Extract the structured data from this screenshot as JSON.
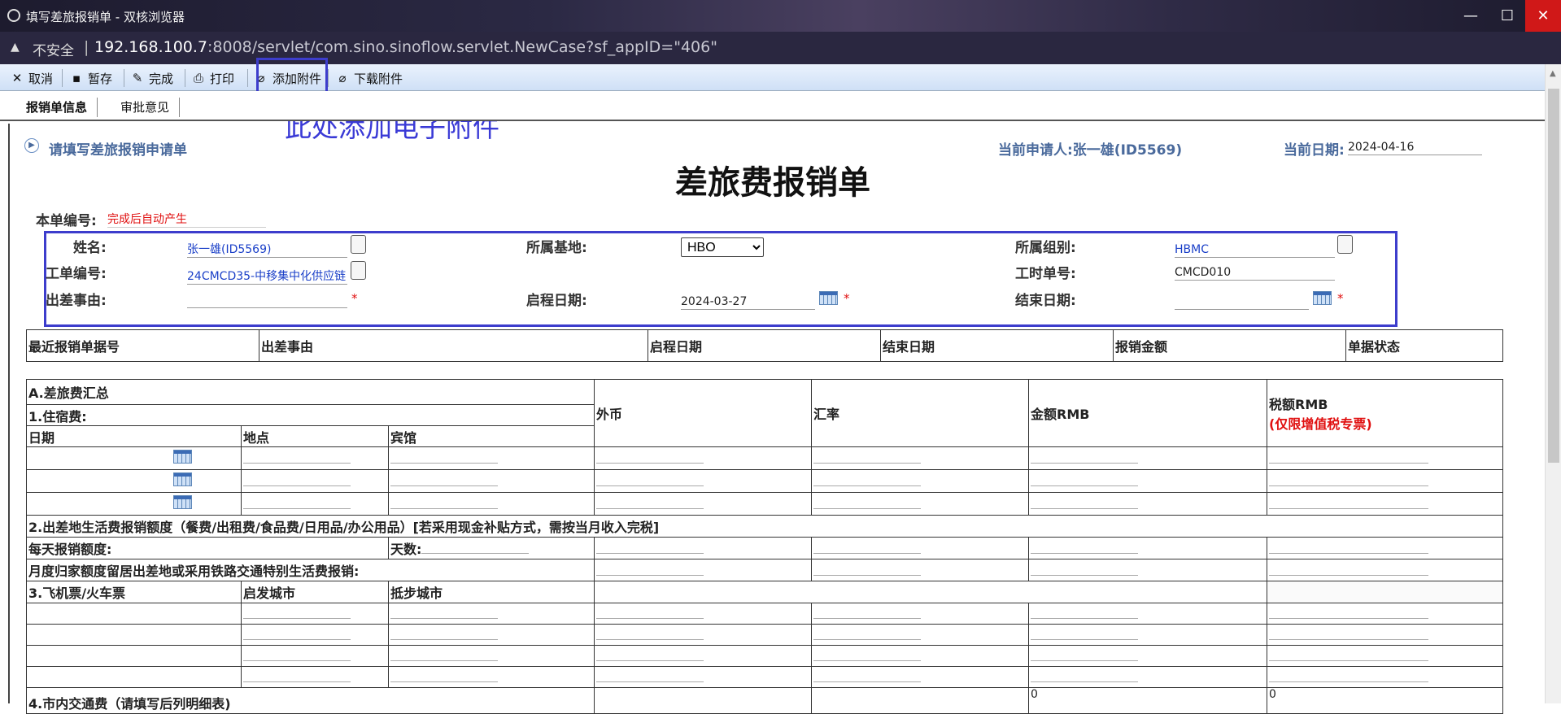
{
  "window": {
    "title": "填写差旅报销单 - 双核浏览器",
    "controls": {
      "minimize": "—",
      "maximize": "☐",
      "close": "✕"
    }
  },
  "address": {
    "insecure_label": "不安全",
    "separator": "|",
    "url_host": "192.168.100.7",
    "url_rest": ":8008/servlet/com.sino.sinoflow.servlet.NewCase?sf_appID=\"406\""
  },
  "toolbar": {
    "cancel": "取消",
    "save_draft": "暂存",
    "complete": "完成",
    "print": "打印",
    "add_attachment": "添加附件",
    "download_attachment": "下载附件"
  },
  "annotation": {
    "text": "此处添加电子附件"
  },
  "tabs": {
    "info": "报销单信息",
    "approval": "审批意见"
  },
  "form": {
    "prompt": "请填写差旅报销申请单",
    "applicant_label": "当前申请人:张一雄(ID5569)",
    "date_label": "当前日期:",
    "date_value": "2024-04-16",
    "title": "差旅费报销单",
    "doc_no_label": "本单编号:",
    "doc_no_value": "完成后自动产生",
    "name_label": "姓名:",
    "name_value": "张一雄(ID5569)",
    "base_label": "所属基地:",
    "base_value": "HBO",
    "group_label": "所属组别:",
    "group_value": "HBMC",
    "work_no_label": "工单编号:",
    "work_no_value": "24CMCD35-中移集中化供应链",
    "hours_no_label": "工时单号:",
    "hours_no_value": "CMCD010",
    "reason_label": "出差事由:",
    "start_label": "启程日期:",
    "start_value": "2024-03-27",
    "end_label": "结束日期:",
    "required_mark": "*"
  },
  "recent_table": {
    "headers": [
      "最近报销单据号",
      "出差事由",
      "启程日期",
      "结束日期",
      "报销金额",
      "单据状态"
    ]
  },
  "expense": {
    "summary": "A.差旅费汇总",
    "lodging": "1.住宿费:",
    "col_date": "日期",
    "col_place": "地点",
    "col_hotel": "宾馆",
    "col_fx": "外币",
    "col_rate": "汇率",
    "col_rmb": "金额RMB",
    "col_tax": "税额RMB",
    "col_tax_note": "(仅限增值税专票)",
    "living": "2.出差地生活费报销额度（餐费/出租费/食品费/日用品/办公用品）[若采用现金补贴方式，需按当月收入完税]",
    "daily_quota": "每天报销额度:",
    "days": "天数:",
    "monthly_home": "月度归家额度留居出差地或采用铁路交通特别生活费报销:",
    "tickets": "3.飞机票/火车票",
    "depart_city": "启发城市",
    "arrive_city": "抵步城市",
    "local_transport": "4.市内交通费（请填写后列明细表)",
    "rmb_total": "0",
    "tax_total": "0"
  }
}
